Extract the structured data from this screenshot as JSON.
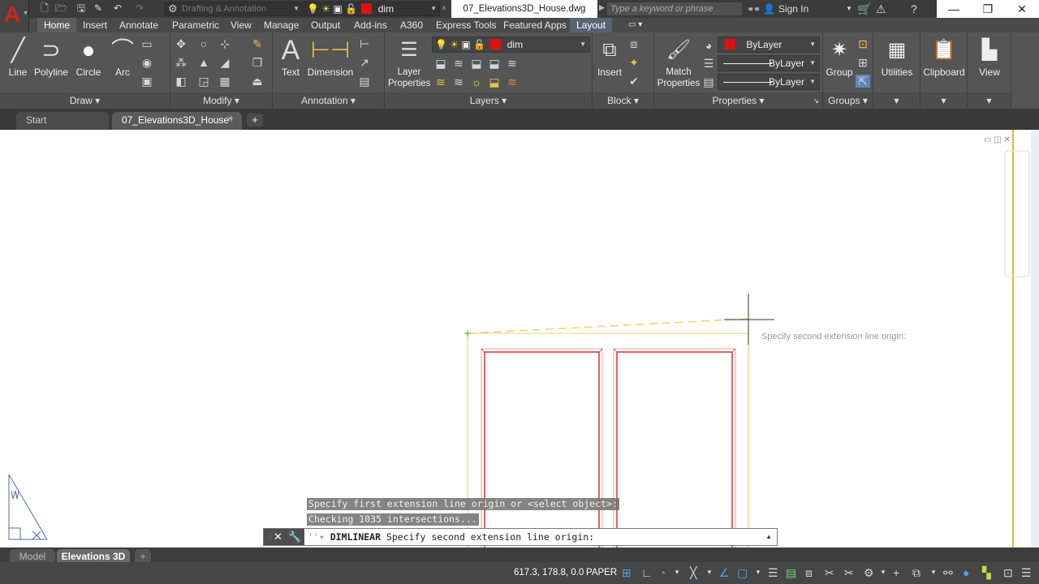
{
  "app": {
    "logo_letter": "A",
    "workspace": "Drafting & Annotation",
    "title_layer": "dim",
    "document_title": "07_Elevations3D_House.dwg",
    "search_placeholder": "Type a keyword or phrase",
    "sign_in": "Sign In",
    "window_controls": {
      "minimize": "—",
      "restore": "❐",
      "close": "✕"
    }
  },
  "ribbon_tabs": [
    {
      "label": "Home",
      "active": true
    },
    {
      "label": "Insert"
    },
    {
      "label": "Annotate"
    },
    {
      "label": "Parametric"
    },
    {
      "label": "View"
    },
    {
      "label": "Manage"
    },
    {
      "label": "Output"
    },
    {
      "label": "Add-ins"
    },
    {
      "label": "A360"
    },
    {
      "label": "Express Tools"
    },
    {
      "label": "Featured Apps"
    },
    {
      "label": "Layout",
      "contextual": true
    }
  ],
  "panels": {
    "draw": {
      "title": "Draw",
      "buttons": [
        "Line",
        "Polyline",
        "Circle",
        "Arc"
      ]
    },
    "modify": {
      "title": "Modify"
    },
    "annotation": {
      "title": "Annotation",
      "buttons": [
        "Text",
        "Dimension"
      ]
    },
    "layers": {
      "title": "Layers",
      "button": "Layer Properties",
      "current_layer": "dim"
    },
    "block": {
      "title": "Block",
      "button": "Insert"
    },
    "properties": {
      "title": "Properties",
      "button": "Match Properties",
      "color": "ByLayer",
      "linetype": "ByLayer",
      "lineweight": "ByLayer"
    },
    "groups": {
      "title": "Groups",
      "button": "Group"
    },
    "utilities": {
      "button": "Utilities"
    },
    "clipboard": {
      "button": "Clipboard"
    },
    "view": {
      "button": "View"
    }
  },
  "colors": {
    "layer_color": "#e01010",
    "autocad_red": "#d81e1e",
    "drawing_red": "#cc0000",
    "drawing_yellow": "#f0c060"
  },
  "doc_tabs": [
    {
      "label": "Start"
    },
    {
      "label": "07_Elevations3D_House*",
      "active": true
    }
  ],
  "canvas": {
    "cursor_tooltip": "Specify second extension line origin:"
  },
  "command_line": {
    "history": [
      "Specify first extension line origin or <select object>:",
      "Checking 1035 intersections..."
    ],
    "command": "DIMLINEAR",
    "prompt": "Specify second extension line origin:"
  },
  "layout_tabs": [
    {
      "label": "Model"
    },
    {
      "label": "Elevations 3D",
      "active": true
    }
  ],
  "status_bar": {
    "coordinates": "617.3, 178.8, 0.0",
    "space": "PAPER"
  }
}
